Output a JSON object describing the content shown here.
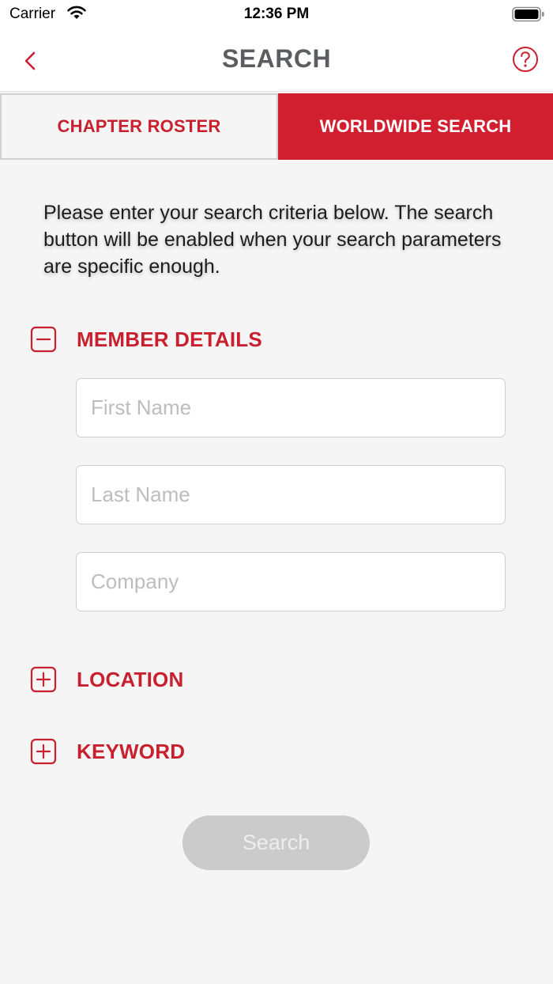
{
  "status_bar": {
    "carrier": "Carrier",
    "time": "12:36 PM"
  },
  "nav": {
    "title": "SEARCH",
    "back_icon": "chevron-left-icon",
    "help_icon": "question-circle-icon"
  },
  "tabs": [
    {
      "label": "CHAPTER ROSTER",
      "active": false
    },
    {
      "label": "WORLDWIDE SEARCH",
      "active": true
    }
  ],
  "intro_text": "Please enter your search criteria below. The search button will be enabled when your search parameters are specific enough.",
  "sections": {
    "member_details": {
      "label": "MEMBER DETAILS",
      "expanded": true,
      "fields": [
        {
          "placeholder": "First Name",
          "value": ""
        },
        {
          "placeholder": "Last Name",
          "value": ""
        },
        {
          "placeholder": "Company",
          "value": ""
        }
      ]
    },
    "location": {
      "label": "LOCATION",
      "expanded": false
    },
    "keyword": {
      "label": "KEYWORD",
      "expanded": false
    }
  },
  "search_button": {
    "label": "Search",
    "enabled": false
  },
  "colors": {
    "brand_red": "#d11f30",
    "text_red": "#c8202f",
    "title_gray": "#5b5d60",
    "disabled_button": "#cbcbcb"
  }
}
